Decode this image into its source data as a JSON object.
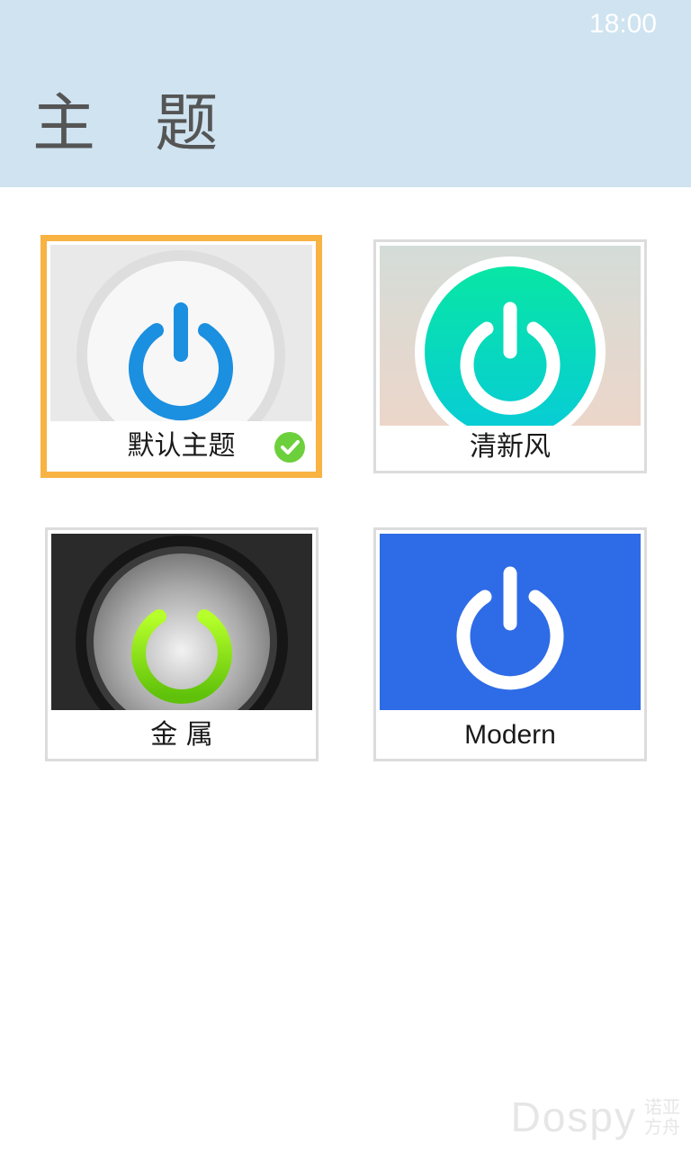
{
  "status_bar": {
    "time": "18:00"
  },
  "header": {
    "title": "主 题"
  },
  "themes": [
    {
      "label": "默认主题",
      "selected": true
    },
    {
      "label": "清新风",
      "selected": false
    },
    {
      "label": "金 属",
      "selected": false
    },
    {
      "label": "Modern",
      "selected": false
    }
  ],
  "watermark": {
    "main": "Dospy",
    "sub": "诺亚方舟"
  },
  "colors": {
    "header_bg": "#cfe3f0",
    "selected_border": "#f8b343",
    "check_green": "#6cd03c",
    "modern_blue": "#2e6be6"
  }
}
